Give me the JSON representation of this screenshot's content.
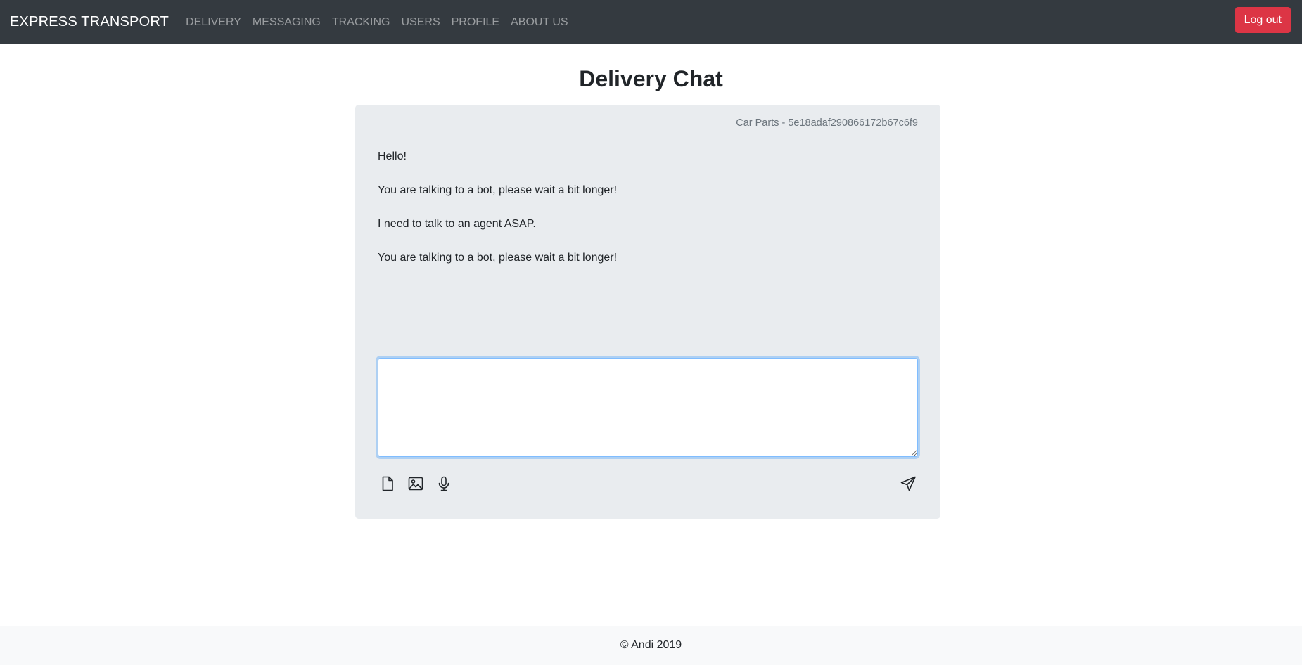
{
  "navbar": {
    "brand": "EXPRESS TRANSPORT",
    "links": [
      "DELIVERY",
      "MESSAGING",
      "TRACKING",
      "USERS",
      "PROFILE",
      "ABOUT US"
    ],
    "logout_label": "Log out",
    "background": "#343a40"
  },
  "page": {
    "title": "Delivery Chat"
  },
  "chat": {
    "subject": "Car Parts - 5e18adaf290866172b67c6f9",
    "messages": [
      "Hello!",
      "You are talking to a bot, please wait a bit longer!",
      "I need to talk to an agent ASAP.",
      "You are talking to a bot, please wait a bit longer!"
    ],
    "input_value": "",
    "toolbar_icons": [
      "file-icon",
      "image-icon",
      "microphone-icon",
      "send-icon"
    ]
  },
  "footer": {
    "text": "© Andi 2019"
  },
  "colors": {
    "danger": "#dc3545",
    "focus": "#80bdff",
    "card": "#e9ecef"
  }
}
